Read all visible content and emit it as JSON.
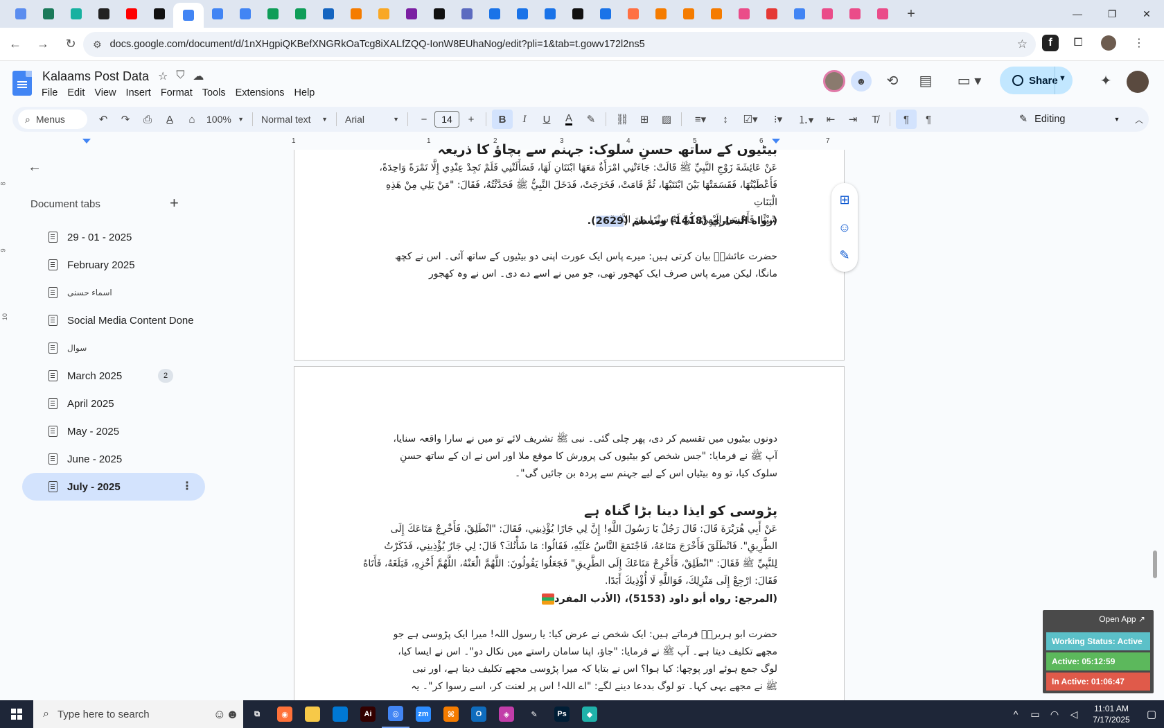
{
  "browser": {
    "tabs": [
      {
        "icon": "tab-icon-1",
        "color": "#5b8def"
      },
      {
        "icon": "tab-icon-2",
        "color": "#1b7a5a"
      },
      {
        "icon": "tab-icon-3",
        "color": "#18b1a0"
      },
      {
        "icon": "chatgpt-icon",
        "color": "#222222"
      },
      {
        "icon": "youtube-icon",
        "color": "#ff0000"
      },
      {
        "icon": "bolt-icon",
        "color": "#111111"
      },
      {
        "icon": "google-docs-icon",
        "color": "#4285f4",
        "active": true
      },
      {
        "icon": "google-docs-icon",
        "color": "#4285f4"
      },
      {
        "icon": "google-docs-icon",
        "color": "#4285f4"
      },
      {
        "icon": "google-sheets-icon",
        "color": "#0f9d58"
      },
      {
        "icon": "google-sheets-icon",
        "color": "#0f9d58"
      },
      {
        "icon": "tab-icon-m",
        "color": "#1565c0"
      },
      {
        "icon": "tab-icon-orange",
        "color": "#f57c00"
      },
      {
        "icon": "tab-icon-v",
        "color": "#f9a825"
      },
      {
        "icon": "tab-icon-braces",
        "color": "#7b1fa2"
      },
      {
        "icon": "tab-icon-a",
        "color": "#111111"
      },
      {
        "icon": "tab-icon-grid",
        "color": "#5c6bc0"
      },
      {
        "icon": "tab-icon-f",
        "color": "#1a73e8"
      },
      {
        "icon": "tab-icon-f",
        "color": "#1a73e8"
      },
      {
        "icon": "tab-icon-f",
        "color": "#1a73e8"
      },
      {
        "icon": "tab-icon-m2",
        "color": "#111111"
      },
      {
        "icon": "tab-icon-f",
        "color": "#1a73e8"
      },
      {
        "icon": "tab-icon-music",
        "color": "#ff7043"
      },
      {
        "icon": "tab-icon-orange",
        "color": "#f57c00"
      },
      {
        "icon": "tab-icon-orange",
        "color": "#f57c00"
      },
      {
        "icon": "tab-icon-orange",
        "color": "#f57c00"
      },
      {
        "icon": "dribbble-icon",
        "color": "#ea4c89"
      },
      {
        "icon": "tab-icon-ring",
        "color": "#e53935"
      },
      {
        "icon": "google-icon",
        "color": "#4285f4"
      },
      {
        "icon": "dribbble-icon",
        "color": "#ea4c89"
      },
      {
        "icon": "dribbble-icon",
        "color": "#ea4c89"
      },
      {
        "icon": "dribbble-icon",
        "color": "#ea4c89"
      }
    ],
    "url": "docs.google.com/document/d/1nXHgpiQKBefXNGRkOaTcg8iXALfZQQ-IonW8EUhaNog/edit?pli=1&tab=t.gowv172l2ns5"
  },
  "docs": {
    "title": "Kalaams Post Data",
    "menu": [
      "File",
      "Edit",
      "View",
      "Insert",
      "Format",
      "Tools",
      "Extensions",
      "Help"
    ],
    "share_label": "Share",
    "toolbar": {
      "menus_label": "Menus",
      "zoom": "100%",
      "style": "Normal text",
      "font": "Arial",
      "font_size": "14",
      "mode": "Editing"
    },
    "ruler_numbers": [
      "1",
      "1",
      "2",
      "3",
      "4",
      "5",
      "6",
      "7"
    ],
    "vruler_numbers": [
      "8",
      "9",
      "10"
    ]
  },
  "sidebar": {
    "heading": "Document tabs",
    "tabs": [
      {
        "label": "29 - 01 - 2025"
      },
      {
        "label": "February 2025"
      },
      {
        "label": "اسماء حسنی",
        "urdu": true
      },
      {
        "label": "Social Media Content Done"
      },
      {
        "label": "سوال",
        "urdu": true
      },
      {
        "label": "March 2025",
        "badge": "2"
      },
      {
        "label": "April 2025"
      },
      {
        "label": "May - 2025"
      },
      {
        "label": "June - 2025"
      },
      {
        "label": "July - 2025",
        "selected": true
      }
    ]
  },
  "content": {
    "page1": {
      "heading_partial": "بیٹیوں کے ساتھ حسنِ سلوک: جہنم سے بچاؤ کا ذریعہ",
      "arabic": [
        "عَنْ عَائِشَةَ زَوْجِ النَّبِيِّ ﷺ قَالَتْ: جَاءَتْنِي امْرَأَةٌ مَعَهَا ابْنَتَانِ لَهَا، فَسَأَلَتْنِي فَلَمْ تَجِدْ عِنْدِي إِلَّا تَمْرَةً وَاحِدَةً،",
        "فَأَعْطَيْتُهَا، فَقَسَمَتْهَا بَيْنَ ابْنَتَيْهَا، ثُمَّ قَامَتْ، فَخَرَجَتْ، فَدَخَلَ النَّبِيُّ ﷺ فَحَدَّثْتُهُ، فَقَالَ: \"مَنْ يَلِي مِنْ هَذِهِ الْبَنَاتِ",
        "شَيْئًا، فَأَحْسَنَ إِلَيْهِنَّ، كُنَّ لَهُ سِتْرًا مِنَ النَّارِ\"."
      ],
      "ref_pre": "(رواه البخاري (1418) ومسلم (",
      "ref_hl": "2629",
      "ref_post": ").",
      "urdu": [
        "حضرت عائشہؓ بیان کرتی ہیں: میرے پاس ایک عورت اپنی دو بیٹیوں کے ساتھ آئی۔ اس نے کچھ",
        "مانگا، لیکن میرے پاس صرف ایک کھجور تھی، جو میں نے اسے دے دی۔ اس نے وہ کھجور"
      ]
    },
    "page2": {
      "urdu_cont": [
        "دونوں بیٹیوں میں تقسیم کر دی، پھر چلی گئی۔ نبی ﷺ تشریف لائے تو میں نے سارا واقعہ سنایا،",
        "آپ ﷺ نے فرمایا: \"جس شخص کو بیٹیوں کی پرورش کا موقع ملا اور اس نے ان کے ساتھ حسنِ",
        "سلوک کیا، تو وہ بیٹیاں اس کے لیے جہنم سے پردہ بن جائیں گی\"۔"
      ],
      "heading": "پڑوسی کو ایذا دینا بڑا گناہ ہے",
      "arabic": [
        "عَنْ أَبِي هُرَيْرَةَ قَالَ: قَالَ رَجُلٌ يَا رَسُولَ اللَّهِ! إِنَّ لِي جَارًا يُؤْذِينِي، فَقَالَ: \"انْطَلِقْ، فَأَخْرِجْ مَتَاعَكَ إِلَى",
        "الطَّرِيقِ\". فَانْطَلَقَ فَأَخْرَجَ مَتَاعَهُ، فَاجْتَمَعَ النَّاسُ عَلَيْهِ، فَقَالُوا: مَا شَأْنُكَ؟ قَالَ: لِي جَارٌ يُؤْذِينِي، فَذَكَرْتُ",
        "لِلنَّبِيِّ ﷺ فَقَالَ: \"انْطَلِقْ، فَأَخْرِجْ مَتَاعَكَ إِلَى الطَّرِيقِ\" فَجَعَلُوا يَقُولُونَ: اللَّهُمَّ الْعَنْهُ، اللَّهُمَّ أَخْزِهِ، فَبَلَغَهُ، فَأَتَاهُ",
        "فَقَالَ: ارْجِعْ إِلَى مَنْزِلِكَ، فَوَاللَّهِ لَا أُؤْذِيكَ أَبَدًا."
      ],
      "ref": "(المرجع: رواه أبو داود (5153)، (الأدب المفرد",
      "urdu": [
        "حضرت ابو ہریرہؓ فرماتے ہیں: ایک شخص نے عرض کیا: یا رسول اللہ! میرا ایک پڑوسی ہے جو",
        "مجھے تکلیف دیتا ہے۔ آپ ﷺ نے فرمایا: \"جاؤ، اپنا سامان راستے میں نکال دو\"۔ اس نے ایسا کیا،",
        "لوگ جمع ہوئے اور پوچھا: کیا ہوا؟ اس نے بتایا کہ میرا پڑوسی مجھے تکلیف دیتا ہے، اور نبی",
        "ﷺ نے مجھے یہی کہا۔ تو لوگ بددعا دینے لگے: \"اے اللہ! اس پر لعنت کر، اسے رسوا کر\"۔ یہ"
      ]
    }
  },
  "status_widget": {
    "open_app": "Open App ↗",
    "working_status": "Working Status: Active",
    "active": "Active: 05:12:59",
    "inactive": "In Active: 01:06:47",
    "colors": {
      "working": "#5bc0c8",
      "active": "#5cb85c",
      "inactive": "#e05a4a"
    }
  },
  "taskbar": {
    "search_placeholder": "Type here to search",
    "apps": [
      {
        "icon": "task-view-icon",
        "color": "#1e2638",
        "glyph": "⧉"
      },
      {
        "icon": "firefox-icon",
        "color": "#ff7139",
        "glyph": "◉"
      },
      {
        "icon": "file-explorer-icon",
        "color": "#f7c948",
        "glyph": ""
      },
      {
        "icon": "vscode-icon",
        "color": "#0078d4",
        "glyph": ""
      },
      {
        "icon": "illustrator-icon",
        "color": "#330000",
        "glyph": "Ai"
      },
      {
        "icon": "chrome-icon",
        "color": "#4285f4",
        "glyph": "◎",
        "active": true
      },
      {
        "icon": "zoom-icon",
        "color": "#2d8cff",
        "glyph": "zm"
      },
      {
        "icon": "orange-app-icon",
        "color": "#f57c00",
        "glyph": "⌘"
      },
      {
        "icon": "outlook-icon",
        "color": "#0f6cbd",
        "glyph": "O"
      },
      {
        "icon": "colorful-app-icon",
        "color": "#c23da9",
        "glyph": "◈"
      },
      {
        "icon": "pen-tool-icon",
        "color": "#1e2638",
        "glyph": "✎"
      },
      {
        "icon": "photoshop-icon",
        "color": "#001e36",
        "glyph": "Ps"
      },
      {
        "icon": "teal-app-icon",
        "color": "#20b2aa",
        "glyph": "◆"
      }
    ],
    "time": "11:01 AM",
    "date": "7/17/2025"
  }
}
